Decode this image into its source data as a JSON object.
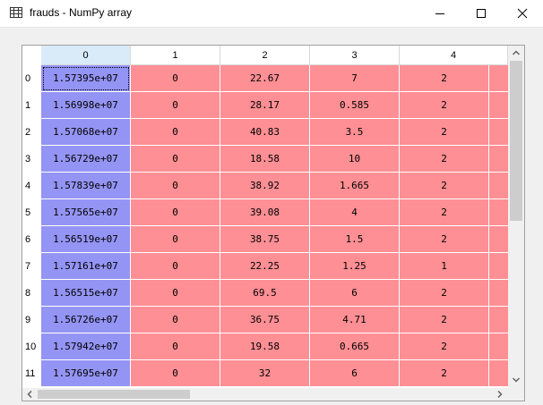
{
  "window": {
    "title": "frauds - NumPy array"
  },
  "table": {
    "columns": [
      "0",
      "1",
      "2",
      "3",
      "4"
    ],
    "row_labels": [
      "0",
      "1",
      "2",
      "3",
      "4",
      "5",
      "6",
      "7",
      "8",
      "9",
      "10",
      "11"
    ],
    "rows": [
      [
        "1.57395e+07",
        "0",
        "22.67",
        "7",
        "2"
      ],
      [
        "1.56998e+07",
        "0",
        "28.17",
        "0.585",
        "2"
      ],
      [
        "1.57068e+07",
        "0",
        "40.83",
        "3.5",
        "2"
      ],
      [
        "1.56729e+07",
        "0",
        "18.58",
        "10",
        "2"
      ],
      [
        "1.57839e+07",
        "0",
        "38.92",
        "1.665",
        "2"
      ],
      [
        "1.57565e+07",
        "0",
        "39.08",
        "4",
        "2"
      ],
      [
        "1.56519e+07",
        "0",
        "38.75",
        "1.5",
        "2"
      ],
      [
        "1.57161e+07",
        "0",
        "22.25",
        "1.25",
        "1"
      ],
      [
        "1.56515e+07",
        "0",
        "69.5",
        "6",
        "2"
      ],
      [
        "1.56726e+07",
        "0",
        "36.75",
        "4.71",
        "2"
      ],
      [
        "1.57942e+07",
        "0",
        "19.58",
        "0.665",
        "2"
      ],
      [
        "1.57695e+07",
        "0",
        "32",
        "6",
        "2"
      ]
    ]
  },
  "colors": {
    "column_0_cell": "#9494f5",
    "other_cell": "#fe8f94",
    "selected_header": "#d9ebf9"
  },
  "icons": {
    "app": "table-icon",
    "minimize": "minimize-icon",
    "maximize": "maximize-icon",
    "close": "close-icon"
  }
}
